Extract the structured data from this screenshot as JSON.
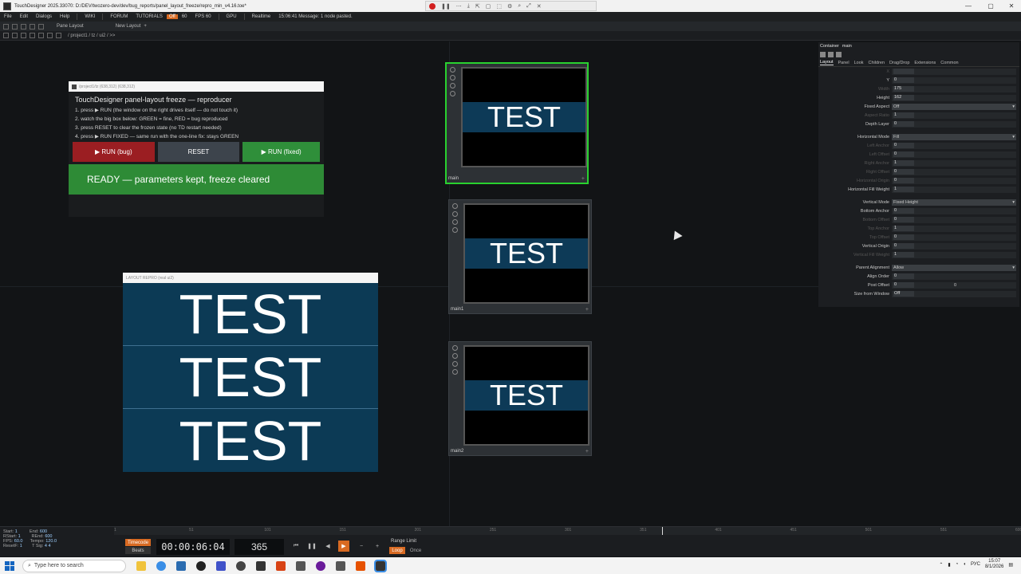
{
  "window": {
    "title": "TouchDesigner 2025.33070: D:/DEV/twozero-dev/dev/bug_reports/panel_layout_freeze/repro_min_v4.16.toe*",
    "minimize_icon": "minimize-icon",
    "maximize_icon": "maximize-icon",
    "close_icon": "close-icon"
  },
  "menu": {
    "items": [
      "File",
      "Edit",
      "Dialogs",
      "Help"
    ],
    "wiki": "WIKI",
    "forum": "FORUM",
    "tutorials": "TUTORIALS",
    "off_badge": "Off",
    "sixty": "60",
    "fps": "FPS  60",
    "gpu": "GPU",
    "realtime": "Realtime",
    "message": "15:06:41 Message: 1 node pasted."
  },
  "panebar": {
    "pane_layout": "Pane Layout",
    "new_layout": "New Layout"
  },
  "path": "/ project1 / tz / ui2 / >>",
  "repro_window": {
    "title": "/project1/tz (638,312) (638,312)",
    "heading": "TouchDesigner panel-layout freeze — reproducer",
    "steps": [
      "1.  press  ▶ RUN  (the window on the right drives itself — do not touch it)",
      "2.  watch the big box below:  GREEN = fine,  RED = bug reproduced",
      "3.  press  RESET  to clear the frozen state (no TD restart needed)",
      "4.  press  ▶ RUN FIXED  — same run with the one-line fix: stays GREEN"
    ],
    "btn_bug": "▶  RUN  (bug)",
    "btn_reset": "RESET",
    "btn_fixed": "▶  RUN  (fixed)",
    "status": "READY  —  parameters kept, freeze cleared",
    "colors": {
      "bug": "#9b1e22",
      "reset": "#3d444c",
      "fixed": "#2f8f3a",
      "ready": "#2e8b36"
    }
  },
  "layout_window": {
    "title": "LAYOUT REPRO (real ui2)",
    "rows": [
      "TEST",
      "TEST",
      "TEST"
    ],
    "bg_color": "#0c3a55"
  },
  "nodes": [
    {
      "label": "main",
      "text": "TEST",
      "selected": true
    },
    {
      "label": "main1",
      "text": "TEST",
      "selected": false
    },
    {
      "label": "main2",
      "text": "TEST",
      "selected": false
    }
  ],
  "params": {
    "op_type": "Container",
    "op_name": "main",
    "tabs": [
      "Layout",
      "Panel",
      "Look",
      "Children",
      "Drag/Drop",
      "Extensions",
      "Common"
    ],
    "rows": [
      {
        "label": "X",
        "value": "",
        "dim": true
      },
      {
        "label": "Y",
        "value": "0",
        "dim": false
      },
      {
        "label": "Width",
        "value": "175",
        "dim": true
      },
      {
        "label": "Height",
        "value": "162",
        "dim": false
      },
      {
        "label": "Fixed Aspect",
        "value": "Off",
        "dim": false,
        "menu": true
      },
      {
        "label": "Aspect Ratio",
        "value": "1",
        "dim": true
      },
      {
        "label": "Depth Layer",
        "value": "0",
        "dim": false
      },
      {
        "label": "",
        "value": "",
        "gap": true
      },
      {
        "label": "Horizontal Mode",
        "value": "Fill",
        "dim": false,
        "menu": true
      },
      {
        "label": "Left Anchor",
        "value": "0",
        "dim": true
      },
      {
        "label": "Left Offset",
        "value": "0",
        "dim": true
      },
      {
        "label": "Right Anchor",
        "value": "1",
        "dim": true
      },
      {
        "label": "Right Offset",
        "value": "0",
        "dim": true
      },
      {
        "label": "Horizontal Origin",
        "value": "0",
        "dim": true
      },
      {
        "label": "Horizontal Fill Weight",
        "value": "1",
        "dim": false
      },
      {
        "label": "",
        "value": "",
        "gap": true
      },
      {
        "label": "Vertical Mode",
        "value": "Fixed Height",
        "dim": false,
        "menu": true
      },
      {
        "label": "Bottom Anchor",
        "value": "0",
        "dim": false
      },
      {
        "label": "Bottom Offset",
        "value": "0",
        "dim": true
      },
      {
        "label": "Top Anchor",
        "value": "1",
        "dim": true
      },
      {
        "label": "Top Offset",
        "value": "0",
        "dim": true
      },
      {
        "label": "Vertical Origin",
        "value": "0",
        "dim": false
      },
      {
        "label": "Vertical Fill Weight",
        "value": "1",
        "dim": true
      },
      {
        "label": "",
        "value": "",
        "gap": true
      },
      {
        "label": "Parent Alignment",
        "value": "Allow",
        "dim": false,
        "menu": true
      },
      {
        "label": "Align Order",
        "value": "0",
        "dim": false
      },
      {
        "label": "Post Offset",
        "value": "0",
        "value2": "0",
        "dim": false
      },
      {
        "label": "Size from Window",
        "value": "Off",
        "dim": false
      }
    ]
  },
  "timeline": {
    "start_label": "Start:",
    "start": "1",
    "end_label": "End:",
    "end": "600",
    "rstart_label": "RStart:",
    "rstart": "1",
    "rend_label": "REnd:",
    "rend": "600",
    "fps_label": "FPS:",
    "fps": "60.0",
    "tempo_label": "Tempo:",
    "tempo": "120.0",
    "resetf_label": "ResetF:",
    "resetf": "1",
    "tsig_label": "T Sig:",
    "tsig": "4   4",
    "timecode_btn": "Timecode",
    "beats_btn": "Beats",
    "timecode": "00:00:06:04",
    "frame": "365",
    "range_limit": "Range Limit",
    "loop": "Loop",
    "once": "Once",
    "ruler_ticks": [
      "1",
      "51",
      "101",
      "151",
      "201",
      "251",
      "301",
      "351",
      "401",
      "451",
      "501",
      "551",
      "600"
    ]
  },
  "taskbar": {
    "search_placeholder": "Type here to search",
    "lang": "РУС",
    "time": "15:07",
    "date": "8/1/2026"
  }
}
